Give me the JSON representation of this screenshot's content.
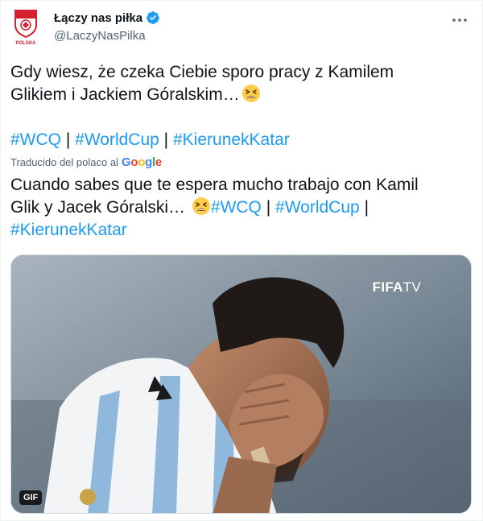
{
  "account": {
    "display_name": "Łączy nas piłka",
    "handle": "@LaczyNasPilka",
    "avatar_badge_text": "POLSKA",
    "verified_icon": "verified-badge-icon"
  },
  "tweet": {
    "line1": "Gdy wiesz, że czeka Ciebie sporo pracy z Kamilem",
    "line2": "Glikiem i Jackiem Góralskim…",
    "emoji": "tired-face-emoji",
    "hashtags": [
      "#WCQ",
      "#WorldCup",
      "#KierunekKatar"
    ],
    "separator": "|"
  },
  "translation": {
    "label": "Traducido del polaco al",
    "provider": "Google",
    "line1": "Cuando sabes que te espera mucho trabajo con Kamil",
    "line2_text": "Glik y Jacek Góralski…",
    "line2_hashtags": [
      "#WCQ",
      "#WorldCup"
    ],
    "line3_hashtag": "#KierunekKatar"
  },
  "media": {
    "watermark_main": "FIFA",
    "watermark_suffix": "TV",
    "badge": "GIF"
  },
  "colors": {
    "link": "#1d9bf0",
    "text": "#0f1419",
    "muted": "#536471",
    "verified": "#1d9bf0"
  }
}
